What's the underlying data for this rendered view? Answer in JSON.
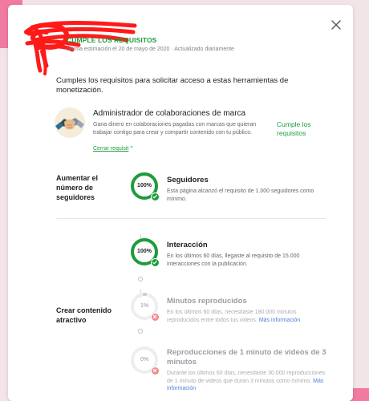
{
  "header": {
    "title": "CUMPLE LOS REQUISITOS",
    "subtitle": "Última estimación el 20 de mayo de 2020 · Actualizado diariamente"
  },
  "intro": "Cumples los requisitos para solicitar acceso a estas herramientas de monetización.",
  "brand_collab": {
    "title": "Administrador de colaboraciones de marca",
    "description": "Gana dinero en colaboraciones pagadas con marcas que quieran trabajar contigo para crear y compartir contenido con tu público.",
    "link": "Cerrar requisit",
    "status": "Cumple los requisitos"
  },
  "sections": [
    {
      "label": "Aumentar el número de seguidores",
      "requirements": [
        {
          "percent": "100%",
          "progress": 1.0,
          "met": true,
          "title": "Seguidores",
          "description": "Esta página alcanzó el requisito de 1.000 seguidores como mínimo."
        }
      ]
    },
    {
      "label": "Crear contenido atractivo",
      "requirements": [
        {
          "percent": "100%",
          "progress": 1.0,
          "met": true,
          "title": "Interacción",
          "description": "En los últimos 60 días, llegaste al requisito de 15.000 interacciones con la publicación."
        },
        {
          "percent": "1%",
          "progress": 0.01,
          "met": false,
          "title": "Minutos reproducidos",
          "description": "En los últimos 60 días, necesitaste 180.000 minutos reproducidos entre todos tus videos.",
          "more_link": "Más información"
        },
        {
          "percent": "0%",
          "progress": 0.0,
          "met": false,
          "title": "Reproducciones de 1 minuto de videos de 3 minutos",
          "description": "Durante los últimos 60 días, necesitaste 30.000 reproducciones de 1 minuto de videos que duran 3 minutos como mínimo.",
          "more_link": "Más información"
        }
      ]
    }
  ],
  "colors": {
    "accent_green": "#1e9c3c",
    "fail_red": "#f28b8b",
    "link_blue": "#4d7fd6",
    "redaction_red": "#ff1a1a",
    "background_pink": "#f07aa0"
  },
  "icons": {
    "close": "close-icon",
    "brand": "handshake-icon",
    "met": "check-icon",
    "unmet": "x-icon"
  }
}
